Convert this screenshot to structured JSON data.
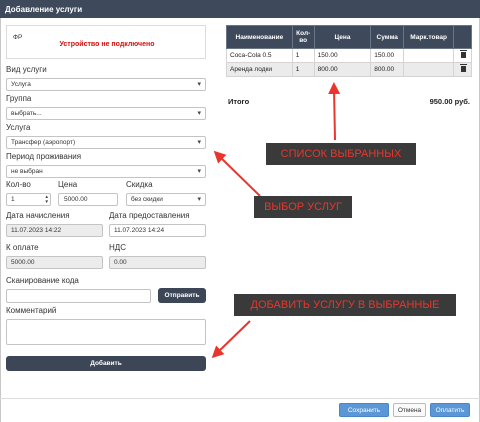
{
  "window": {
    "title": "Добавление услуги"
  },
  "fiscal": {
    "label": "ФР",
    "status": "Устройство не подключено"
  },
  "form": {
    "service_type": {
      "label": "Вид услуги",
      "value": "Услуга"
    },
    "group": {
      "label": "Группа",
      "value": "выбрать..."
    },
    "service": {
      "label": "Услуга",
      "value": "Трансфер (аэропорт)"
    },
    "stay_period": {
      "label": "Период проживания",
      "value": "не выбран"
    },
    "qty": {
      "label": "Кол-во",
      "value": "1"
    },
    "price": {
      "label": "Цена",
      "value": "5000.00"
    },
    "discount": {
      "label": "Скидка",
      "value": "без скидки"
    },
    "accrual_date": {
      "label": "Дата начисления",
      "value": "11.07.2023 14:22"
    },
    "provide_date": {
      "label": "Дата предоставления",
      "value": "11.07.2023 14:24"
    },
    "to_pay": {
      "label": "К оплате",
      "value": "5000.00"
    },
    "vat": {
      "label": "НДС",
      "value": "0.00"
    },
    "scan": {
      "label": "Сканирование кода",
      "value": "",
      "send_label": "Отправить"
    },
    "comment": {
      "label": "Комментарий",
      "value": ""
    },
    "add_label": "Добавить"
  },
  "table": {
    "headers": [
      "Наименование",
      "Кол-во",
      "Цена",
      "Сумма",
      "Марк.товар"
    ],
    "rows": [
      {
        "name": "Coca-Cola 0.5",
        "qty": "1",
        "price": "150.00",
        "sum": "150.00",
        "mark": ""
      },
      {
        "name": "Аренда лодки",
        "qty": "1",
        "price": "800.00",
        "sum": "800.00",
        "mark": ""
      }
    ],
    "total_label": "Итого",
    "total_value": "950.00 руб."
  },
  "annotations": {
    "selected_list": "СПИСОК  ВЫБРАННЫХ",
    "service_choice": "ВЫБОР УСЛУГ",
    "add_to_selected": "ДОБАВИТЬ УСЛУГУ В  ВЫБРАННЫЕ",
    "color": "#e8362c"
  },
  "footer": {
    "save": "Сохранить",
    "cancel": "Отмена",
    "pay": "Оплатить"
  },
  "colors": {
    "header": "#3e4a5c",
    "primary_button": "#5b97d6",
    "dark_button": "#3c4656"
  }
}
